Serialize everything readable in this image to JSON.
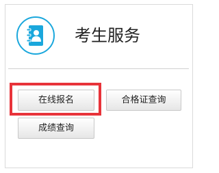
{
  "panel": {
    "title": "考生服务",
    "icon": "contact-book-icon",
    "accent_color": "#1aa7dc",
    "highlight_color": "#e8333a"
  },
  "buttons": {
    "signup_label": "在线报名",
    "certificate_label": "合格证查询",
    "score_label": "成绩查询"
  }
}
